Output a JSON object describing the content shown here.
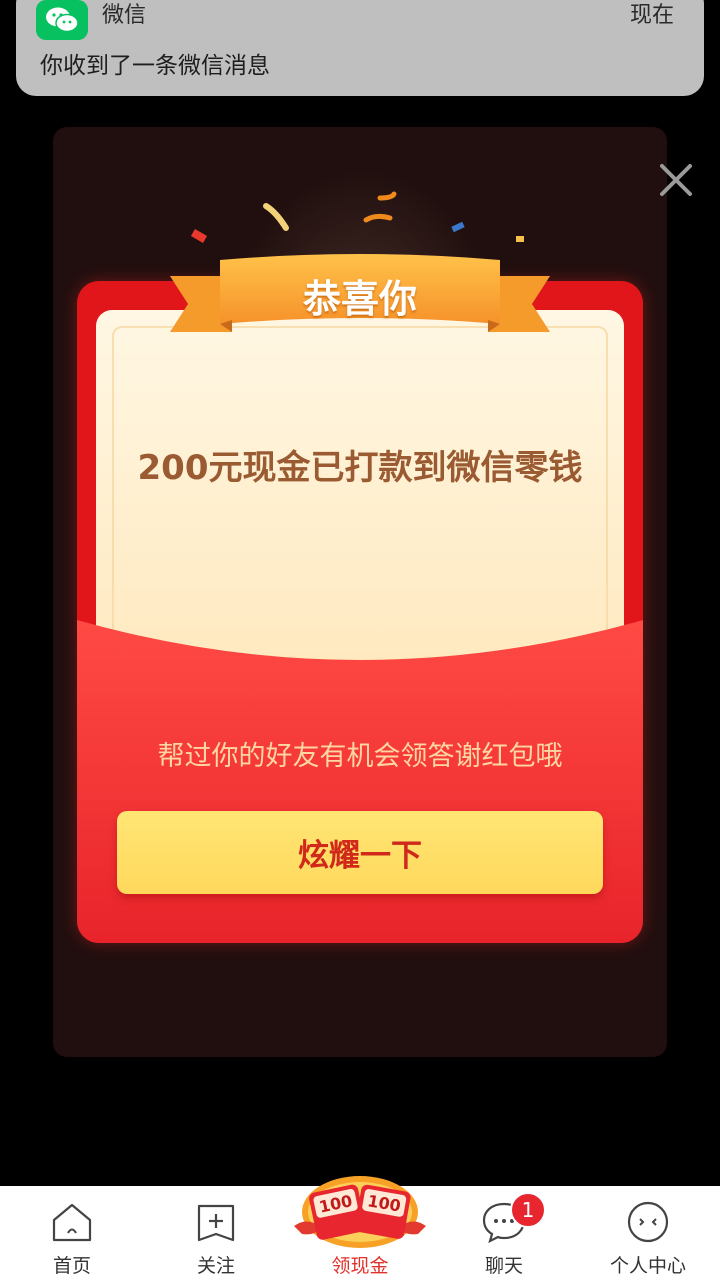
{
  "notification": {
    "app_name": "微信",
    "time": "现在",
    "message": "你收到了一条微信消息",
    "icon": "wechat-icon"
  },
  "popup": {
    "ribbon_title": "恭喜你",
    "amount_text": "200元现金已打款到微信零钱",
    "hint_text": "帮过你的好友有机会领答谢红包哦",
    "share_button": "炫耀一下",
    "close_icon": "close-icon"
  },
  "tabbar": {
    "items": [
      {
        "label": "首页",
        "icon": "home-icon"
      },
      {
        "label": "关注",
        "icon": "plus-square-icon"
      },
      {
        "label": "领现金",
        "icon": "red-envelope-icon",
        "active": true,
        "envelope_values": [
          "100",
          "100"
        ]
      },
      {
        "label": "聊天",
        "icon": "chat-bubble-icon",
        "badge": "1"
      },
      {
        "label": "个人中心",
        "icon": "smiley-face-icon"
      }
    ]
  },
  "colors": {
    "envelope_red": "#e0161b",
    "button_yellow": "#ffd85c",
    "amount_brown": "#9a5a32",
    "active_tab": "#e0322b"
  }
}
